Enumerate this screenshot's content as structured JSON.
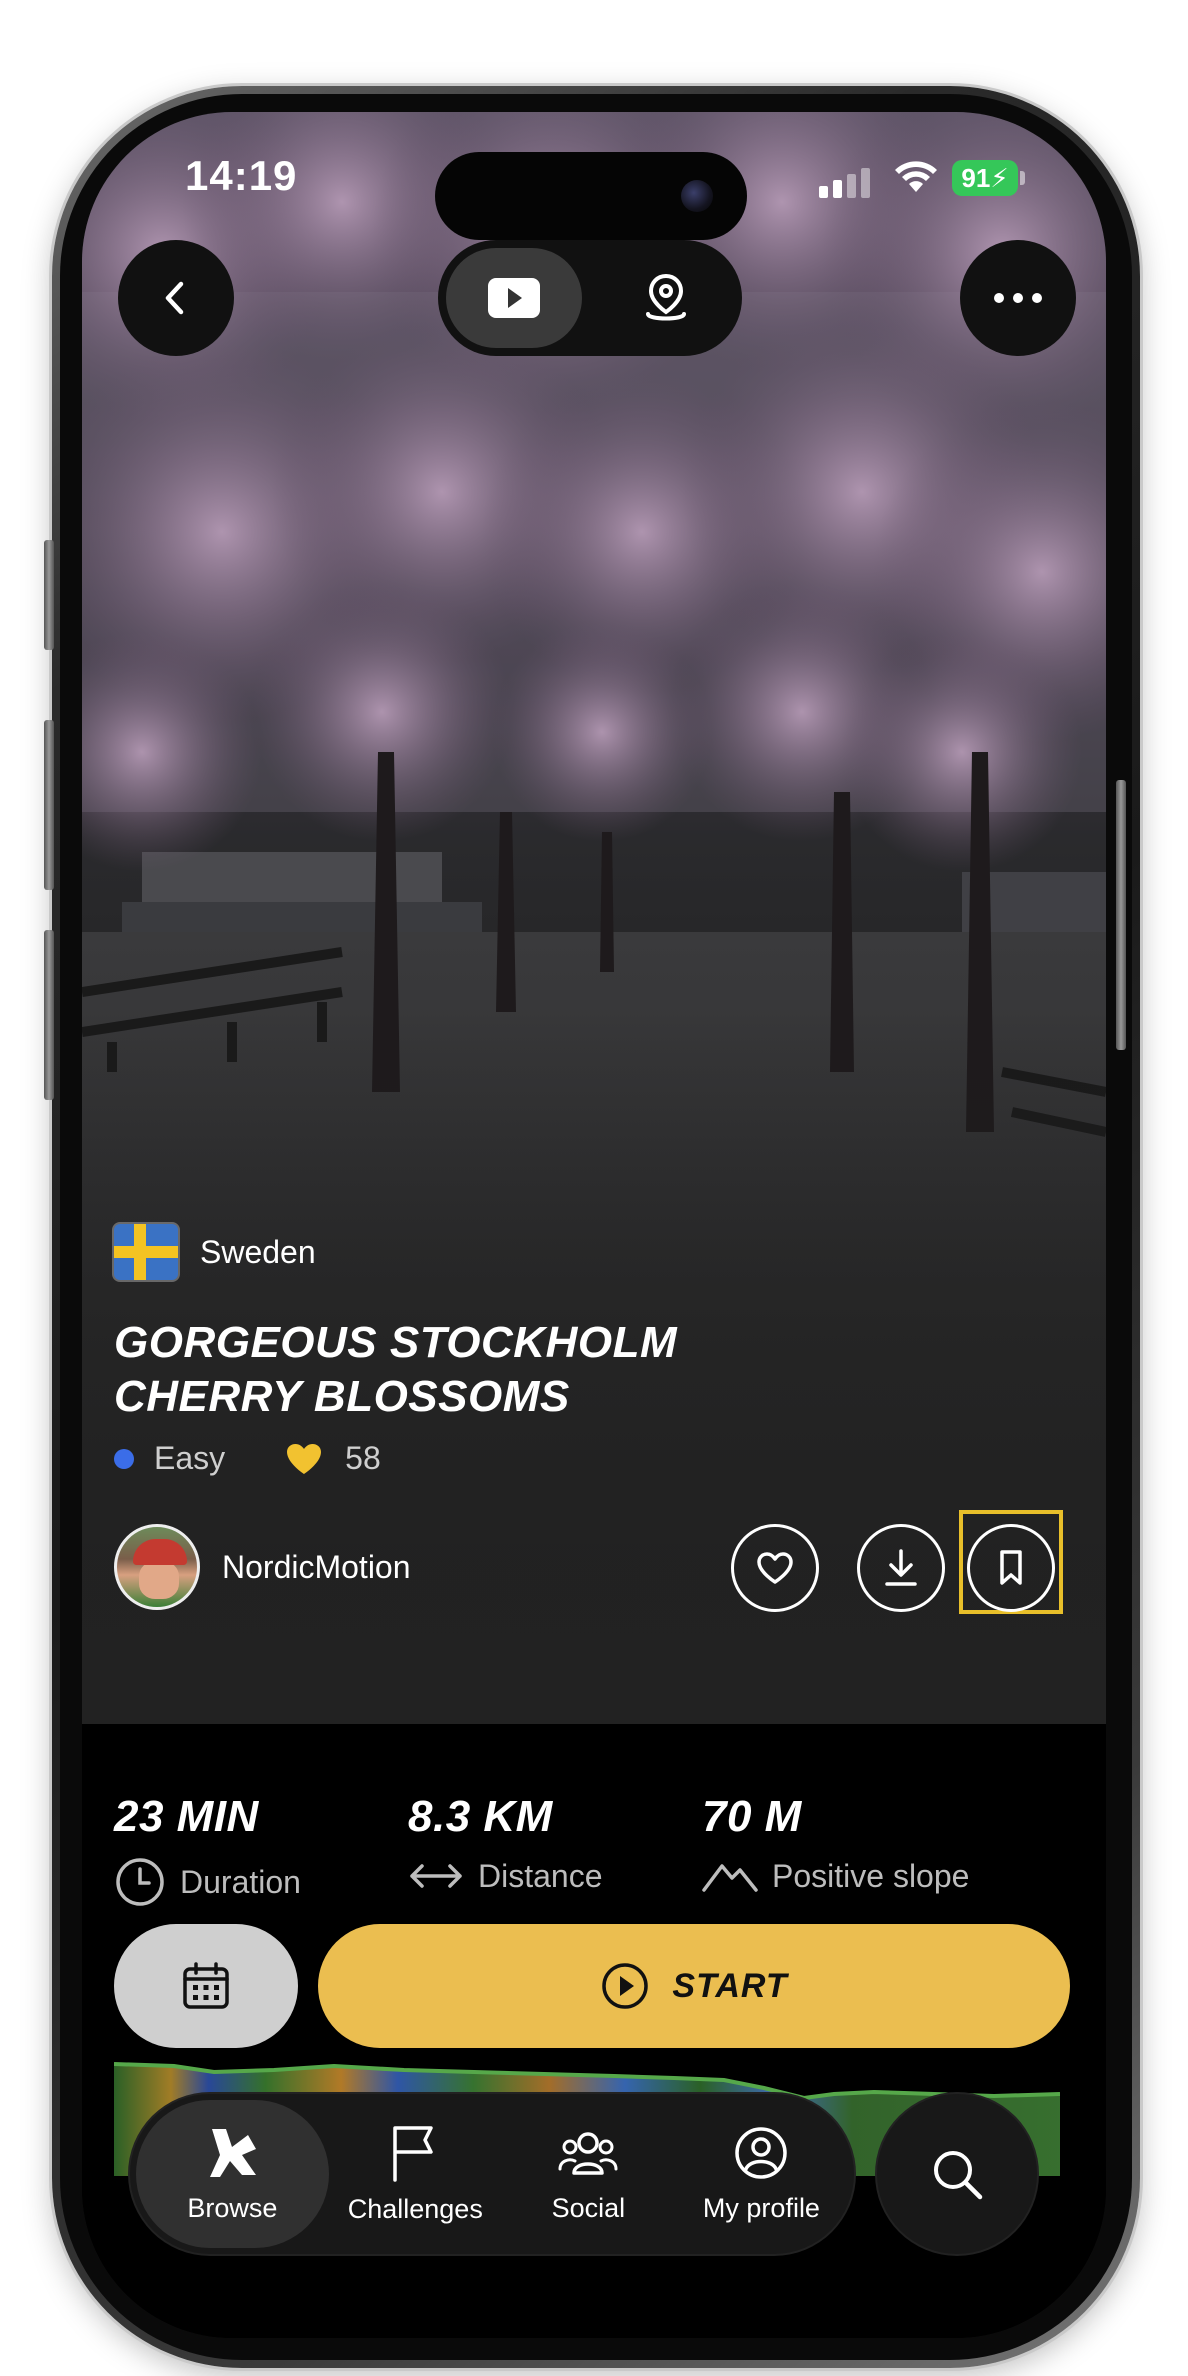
{
  "status_bar": {
    "time": "14:19",
    "battery": "91"
  },
  "route": {
    "country": "Sweden",
    "title_line1": "GORGEOUS STOCKHOLM",
    "title_line2": "CHERRY BLOSSOMS",
    "difficulty": "Easy",
    "likes": "58",
    "author": "NordicMotion"
  },
  "stats": [
    {
      "value": "23 MIN",
      "label": "Duration"
    },
    {
      "value": "8.3 KM",
      "label": "Distance"
    },
    {
      "value": "70 M",
      "label": "Positive slope"
    }
  ],
  "actions": {
    "start_label": "START"
  },
  "tabs": [
    {
      "label": "Browse",
      "icon": "browse-icon",
      "active": true
    },
    {
      "label": "Challenges",
      "icon": "flag-icon"
    },
    {
      "label": "Social",
      "icon": "people-icon"
    },
    {
      "label": "My profile",
      "icon": "profile-icon"
    }
  ],
  "colors": {
    "accent_yellow": "#ebbe50",
    "difficulty_blue": "#3b6de8",
    "highlight_border": "#e8bf2a"
  }
}
